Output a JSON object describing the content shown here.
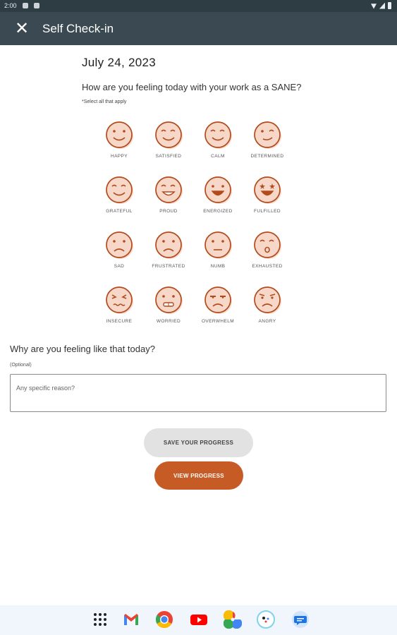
{
  "status_bar": {
    "time": "2:00"
  },
  "app_bar": {
    "close_glyph": "✕",
    "title": "Self Check-in"
  },
  "date": "July 24, 2023",
  "question": "How are you feeling today with your work as a SANE?",
  "hint": "*Select all that apply",
  "emotions": [
    {
      "label": "HAPPY",
      "icon": "happy-face-icon",
      "mouth": "smile",
      "eyes": "dot"
    },
    {
      "label": "SATISFIED",
      "icon": "satisfied-face-icon",
      "mouth": "smile",
      "eyes": "closed"
    },
    {
      "label": "CALM",
      "icon": "calm-face-icon",
      "mouth": "smile",
      "eyes": "closed"
    },
    {
      "label": "DETERMINED",
      "icon": "determined-face-icon",
      "mouth": "smirk",
      "eyes": "wink"
    },
    {
      "label": "GRATEFUL",
      "icon": "grateful-face-icon",
      "mouth": "smile",
      "eyes": "closed"
    },
    {
      "label": "PROUD",
      "icon": "proud-face-icon",
      "mouth": "grin",
      "eyes": "closed"
    },
    {
      "label": "ENERGIZED",
      "icon": "energized-face-icon",
      "mouth": "open",
      "eyes": "dot"
    },
    {
      "label": "FULFILLED",
      "icon": "fulfilled-face-icon",
      "mouth": "open",
      "eyes": "star"
    },
    {
      "label": "SAD",
      "icon": "sad-face-icon",
      "mouth": "frown",
      "eyes": "dot"
    },
    {
      "label": "FRUSTRATED",
      "icon": "frustrated-face-icon",
      "mouth": "frown",
      "eyes": "dot"
    },
    {
      "label": "NUMB",
      "icon": "numb-face-icon",
      "mouth": "flat",
      "eyes": "dot"
    },
    {
      "label": "EXHAUSTED",
      "icon": "exhausted-face-icon",
      "mouth": "o",
      "eyes": "closed"
    },
    {
      "label": "INSECURE",
      "icon": "insecure-face-icon",
      "mouth": "wavy",
      "eyes": "squint"
    },
    {
      "label": "WORRIED",
      "icon": "worried-face-icon",
      "mouth": "teeth",
      "eyes": "dot"
    },
    {
      "label": "OVERWHELM",
      "icon": "overwhelm-face-icon",
      "mouth": "frown",
      "eyes": "half"
    },
    {
      "label": "ANGRY",
      "icon": "angry-face-icon",
      "mouth": "frown",
      "eyes": "angry"
    }
  ],
  "reason": {
    "question": "Why are you feeling like that today?",
    "optional_label": "(Optional)",
    "placeholder": "Any specific reason?"
  },
  "buttons": {
    "save": "SAVE YOUR PROGRESS",
    "view": "VIEW PROGRESS"
  },
  "colors": {
    "accent": "#c75b26",
    "face_fill": "#f6d7c8",
    "face_stroke": "#b24a1c",
    "app_bar": "#3b4a52"
  },
  "dock": [
    {
      "name": "app-drawer-icon"
    },
    {
      "name": "gmail-icon"
    },
    {
      "name": "chrome-icon"
    },
    {
      "name": "youtube-icon"
    },
    {
      "name": "photos-icon"
    },
    {
      "name": "assistant-icon"
    },
    {
      "name": "messages-icon"
    }
  ]
}
